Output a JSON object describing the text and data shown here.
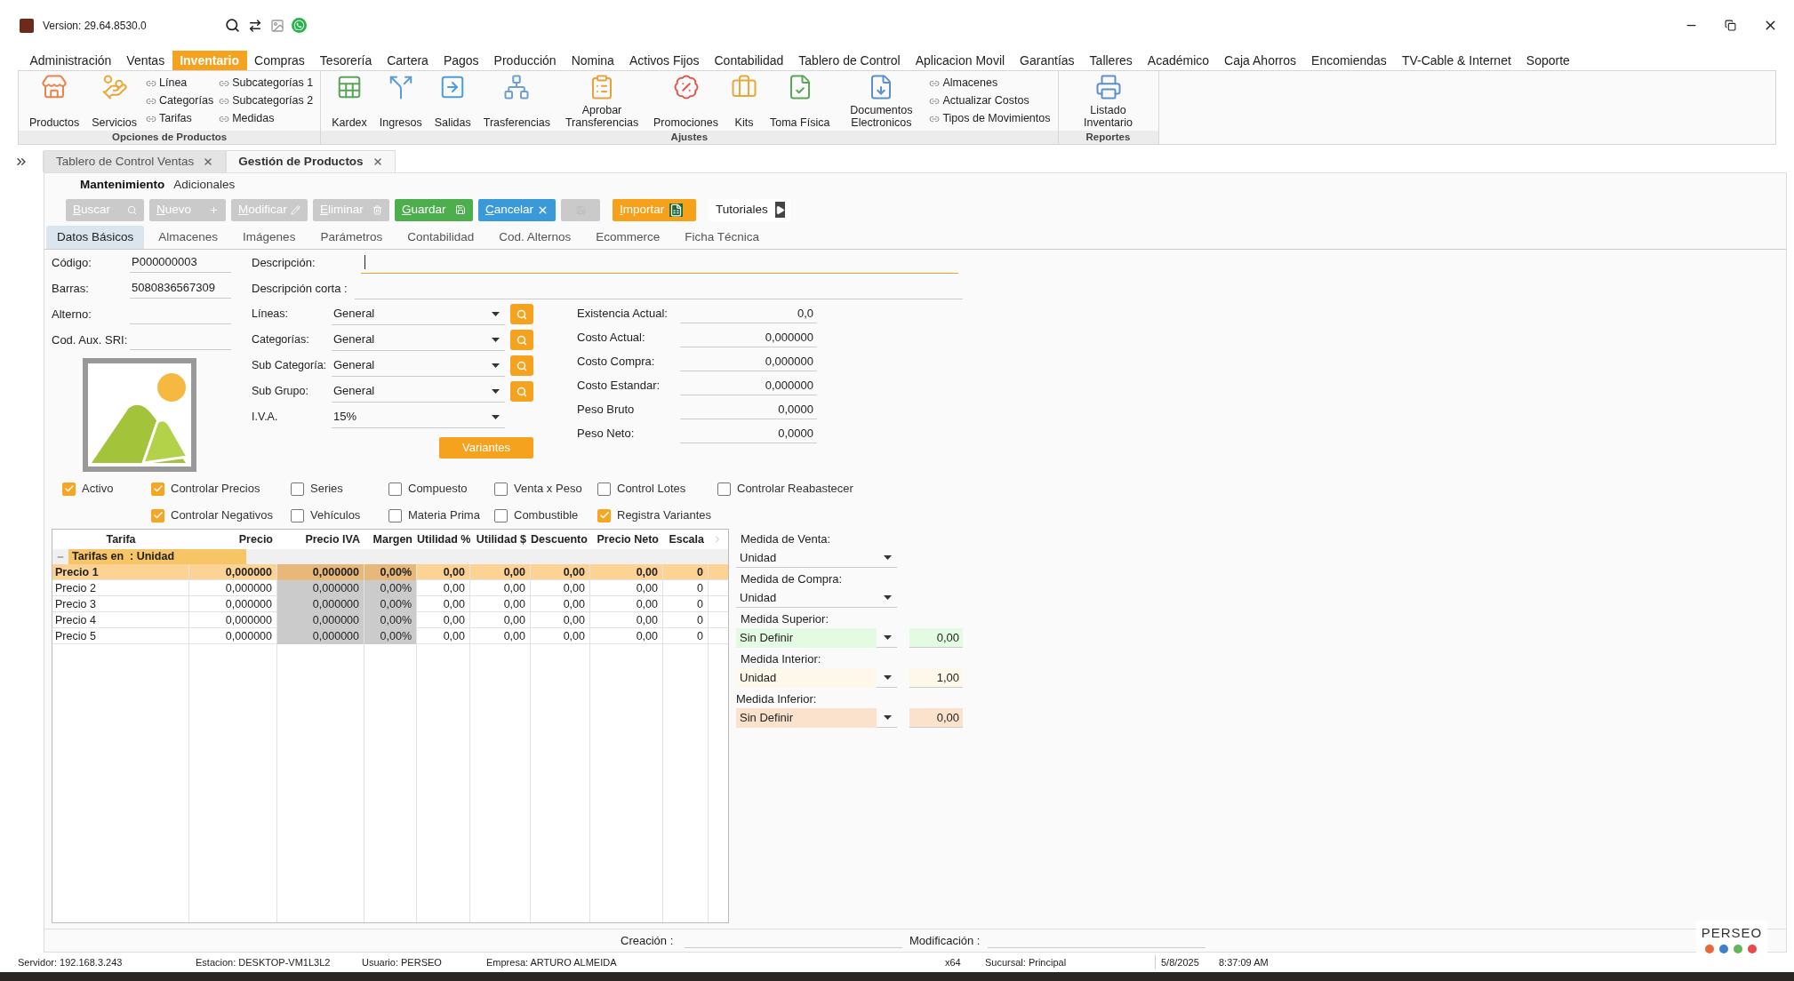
{
  "window": {
    "version": "Version: 29.64.8530.0"
  },
  "menu": [
    {
      "label": "Administración",
      "selected": false
    },
    {
      "label": "Ventas",
      "selected": false
    },
    {
      "label": "Inventario",
      "selected": true
    },
    {
      "label": "Compras",
      "selected": false
    },
    {
      "label": "Tesorería",
      "selected": false
    },
    {
      "label": "Cartera",
      "selected": false
    },
    {
      "label": "Pagos",
      "selected": false
    },
    {
      "label": "Producción",
      "selected": false
    },
    {
      "label": "Nomina",
      "selected": false
    },
    {
      "label": "Activos Fijos",
      "selected": false
    },
    {
      "label": "Contabilidad",
      "selected": false
    },
    {
      "label": "Tablero de Control",
      "selected": false
    },
    {
      "label": "Aplicacion Movil",
      "selected": false
    },
    {
      "label": "Garantías",
      "selected": false
    },
    {
      "label": "Talleres",
      "selected": false
    },
    {
      "label": "Académico",
      "selected": false
    },
    {
      "label": "Caja Ahorros",
      "selected": false
    },
    {
      "label": "Encomiendas",
      "selected": false
    },
    {
      "label": "TV-Cable & Internet",
      "selected": false
    },
    {
      "label": "Soporte",
      "selected": false
    }
  ],
  "ribbon": [
    {
      "title": "Opciones de Productos",
      "items": [
        {
          "kind": "large",
          "label": "Productos"
        },
        {
          "kind": "large",
          "label": "Servicios"
        },
        {
          "kind": "links",
          "links": [
            "Línea",
            "Categorías",
            "Tarifas"
          ]
        },
        {
          "kind": "links",
          "links": [
            "Subcategorías 1",
            "Subcategorías 2",
            "Medidas"
          ]
        }
      ]
    },
    {
      "title": "Ajustes",
      "items": [
        {
          "kind": "large",
          "label": "Kardex"
        },
        {
          "kind": "large",
          "label": "Ingresos"
        },
        {
          "kind": "large",
          "label": "Salidas"
        },
        {
          "kind": "large",
          "label": "Trasferencias"
        },
        {
          "kind": "large",
          "label": "Aprobar Transferencias"
        },
        {
          "kind": "large",
          "label": "Promociones"
        },
        {
          "kind": "large",
          "label": "Kits"
        },
        {
          "kind": "large",
          "label": "Toma Física"
        },
        {
          "kind": "large",
          "label": "Documentos Electronicos"
        },
        {
          "kind": "links",
          "links": [
            "Almacenes",
            "Actualizar Costos",
            "Tipos de Movimientos"
          ]
        }
      ]
    },
    {
      "title": "Reportes",
      "items": [
        {
          "kind": "large",
          "label": "Listado Inventario"
        }
      ]
    }
  ],
  "doc_tabs": [
    {
      "label": "Tablero de Control Ventas",
      "selected": false
    },
    {
      "label": "Gestión de Productos",
      "selected": true
    }
  ],
  "sub_tabs": [
    {
      "label": "Mantenimiento",
      "selected": true
    },
    {
      "label": "Adicionales",
      "selected": false
    }
  ],
  "toolbar": [
    {
      "kind": "search",
      "label": "Buscar",
      "disabled": true
    },
    {
      "kind": "new",
      "label": "Nuevo",
      "disabled": true
    },
    {
      "kind": "edit",
      "label": "Modificar",
      "disabled": true
    },
    {
      "kind": "delete",
      "label": "Eliminar",
      "disabled": true
    },
    {
      "kind": "save",
      "label": "Guardar",
      "disabled": false
    },
    {
      "kind": "cancel",
      "label": "Cancelar",
      "disabled": false
    },
    {
      "kind": "blank",
      "disabled": true
    },
    {
      "kind": "import",
      "label": "Importar",
      "disabled": false
    },
    {
      "kind": "tutorial",
      "label": "Tutoriales",
      "disabled": false
    }
  ],
  "content_tabs": [
    {
      "label": "Datos Básicos",
      "selected": true
    },
    {
      "label": "Almacenes",
      "selected": false
    },
    {
      "label": "Imágenes",
      "selected": false
    },
    {
      "label": "Parámetros",
      "selected": false
    },
    {
      "label": "Contabilidad",
      "selected": false
    },
    {
      "label": "Cod. Alternos",
      "selected": false
    },
    {
      "label": "Ecommerce",
      "selected": false
    },
    {
      "label": "Ficha Técnica",
      "selected": false
    }
  ],
  "codes": [
    {
      "label": "Código:",
      "value": "P000000003"
    },
    {
      "label": "Barras:",
      "value": "5080836567309"
    },
    {
      "label": "Alterno:"
    },
    {
      "label": "Cod. Aux. SRI:"
    }
  ],
  "descriptions": [
    {
      "label": "Descripción:",
      "focused": true
    },
    {
      "label": "Descripción corta :",
      "focused": false
    }
  ],
  "combos": [
    {
      "label": "Líneas:",
      "value": "General",
      "lookup": true
    },
    {
      "label": "Categorías:",
      "value": "General",
      "lookup": true
    },
    {
      "label": "Sub Categoría:",
      "value": "General",
      "lookup": true
    },
    {
      "label": "Sub Grupo:",
      "value": "General",
      "lookup": true
    },
    {
      "label": "I.V.A.",
      "value": "15%",
      "lookup": false
    }
  ],
  "amounts": [
    {
      "label": "Existencia Actual:",
      "value": "0,0"
    },
    {
      "label": "Costo Actual:",
      "value": "0,000000"
    },
    {
      "label": "Costo Compra:",
      "value": "0,000000"
    },
    {
      "label": "Costo Estandar:",
      "value": "0,000000"
    },
    {
      "label": "Peso Bruto",
      "value": "0,0000"
    },
    {
      "label": "Peso Neto:",
      "value": "0,0000"
    }
  ],
  "variants_button": "Variantes",
  "checkbox_rows": [
    [
      {
        "label": "Activo",
        "checked": true
      },
      {
        "label": "Controlar Precios",
        "checked": true
      },
      {
        "label": "Series",
        "checked": false
      },
      {
        "label": "Compuesto",
        "checked": false
      },
      {
        "label": "Venta x Peso",
        "checked": false
      },
      {
        "label": "Control Lotes",
        "checked": false
      },
      {
        "label": "Controlar Reabastecer",
        "checked": false
      }
    ],
    [
      {
        "label": "Controlar Negativos",
        "checked": true
      },
      {
        "label": "Vehículos",
        "checked": false
      },
      {
        "label": "Materia Prima",
        "checked": false
      },
      {
        "label": "Combustible",
        "checked": false
      },
      {
        "label": "Registra Variantes",
        "checked": true
      }
    ]
  ],
  "tariffs": {
    "columns": [
      "Tarifa",
      "Precio",
      "Precio IVA",
      "Margen",
      "Utilidad %",
      "Utilidad $",
      "Descuento",
      "Precio Neto",
      "Escala"
    ],
    "group": {
      "label": "Tarifas en  : Unidad",
      "expanded": true
    },
    "rows": [
      {
        "cells": [
          "Precio 1",
          "0,000000",
          "0,000000",
          "0,00%",
          "0,00",
          "0,00",
          "0,00",
          "0,00",
          "0"
        ],
        "selected": true
      },
      {
        "cells": [
          "Precio 2",
          "0,000000",
          "0,000000",
          "0,00%",
          "0,00",
          "0,00",
          "0,00",
          "0,00",
          "0"
        ],
        "selected": false
      },
      {
        "cells": [
          "Precio 3",
          "0,000000",
          "0,000000",
          "0,00%",
          "0,00",
          "0,00",
          "0,00",
          "0,00",
          "0"
        ],
        "selected": false
      },
      {
        "cells": [
          "Precio 4",
          "0,000000",
          "0,000000",
          "0,00%",
          "0,00",
          "0,00",
          "0,00",
          "0,00",
          "0"
        ],
        "selected": false
      },
      {
        "cells": [
          "Precio 5",
          "0,000000",
          "0,000000",
          "0,00%",
          "0,00",
          "0,00",
          "0,00",
          "0,00",
          "0"
        ],
        "selected": false
      }
    ]
  },
  "measures": [
    {
      "label": "Medida de Venta:",
      "value": "Unidad"
    },
    {
      "label": "Medida de Compra:",
      "value": "Unidad"
    },
    {
      "label": "Medida Superior:",
      "value": "Sin Definir",
      "color": "#e3fbe3",
      "amount": "0,00"
    },
    {
      "label": "Medida Interior:",
      "value": "Unidad",
      "color": "#fdf8ea",
      "amount": "1,00"
    },
    {
      "label": "Medida Inferior:",
      "value": "Sin Definir",
      "color": "#fbe2cc",
      "amount": "0,00"
    }
  ],
  "footer": {
    "created_label": "Creación :",
    "modified_label": "Modificación :"
  },
  "status_bar": [
    "Servidor: 192.168.3.243",
    "Estacion: DESKTOP-VM1L3L2",
    "Usuario: PERSEO",
    "Empresa: ARTURO ALMEIDA",
    "x64",
    "Sucursal: Principal",
    "5/8/2025",
    "8:37:09 AM"
  ],
  "logo": {
    "brand": "PERSEO"
  }
}
